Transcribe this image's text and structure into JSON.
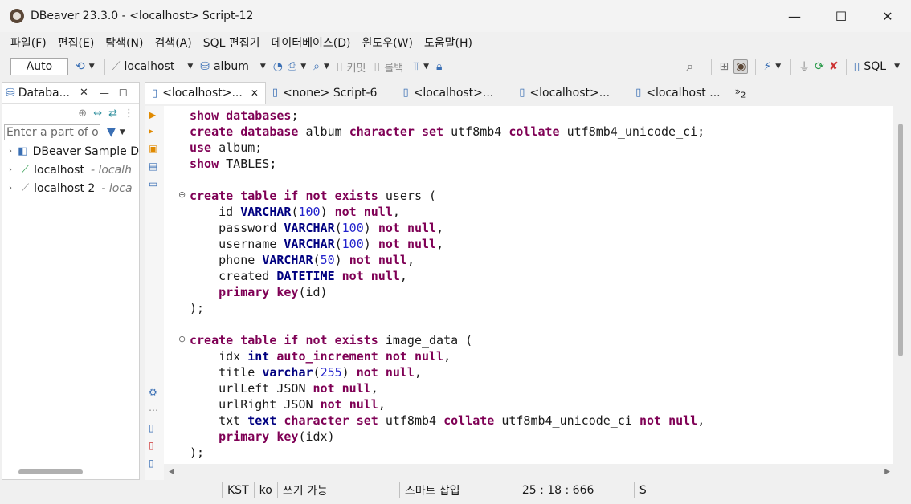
{
  "window": {
    "title": "DBeaver 23.3.0 - <localhost> Script-12",
    "minimize": "—",
    "maximize": "☐",
    "close": "✕"
  },
  "menu": [
    "파일(F)",
    "편집(E)",
    "탐색(N)",
    "검색(A)",
    "SQL 편집기",
    "데이터베이스(D)",
    "윈도우(W)",
    "도움말(H)"
  ],
  "toolbar": {
    "transaction_mode": "Auto",
    "connection": "localhost",
    "schema": "album",
    "commit": "커밋",
    "rollback": "롤백",
    "perspective": "SQL"
  },
  "navigator": {
    "tab_title": "Databa...",
    "filter_placeholder": "Enter a part of ol",
    "items": [
      {
        "label": "DBeaver Sample D",
        "sub": ""
      },
      {
        "label": "localhost",
        "sub": "- localh"
      },
      {
        "label": "localhost 2",
        "sub": "- loca"
      }
    ]
  },
  "editor_tabs": [
    {
      "label": "<localhost>...",
      "active": true
    },
    {
      "label": "<none> Script-6"
    },
    {
      "label": "<localhost>..."
    },
    {
      "label": "<localhost>..."
    },
    {
      "label": "<localhost ..."
    }
  ],
  "more_tabs": "2",
  "status": {
    "timezone": "KST",
    "locale": "ko",
    "write_mode": "쓰기 가능",
    "insert_mode": "스마트 삽입",
    "position": "25 : 18 : 666",
    "extra": "S"
  }
}
